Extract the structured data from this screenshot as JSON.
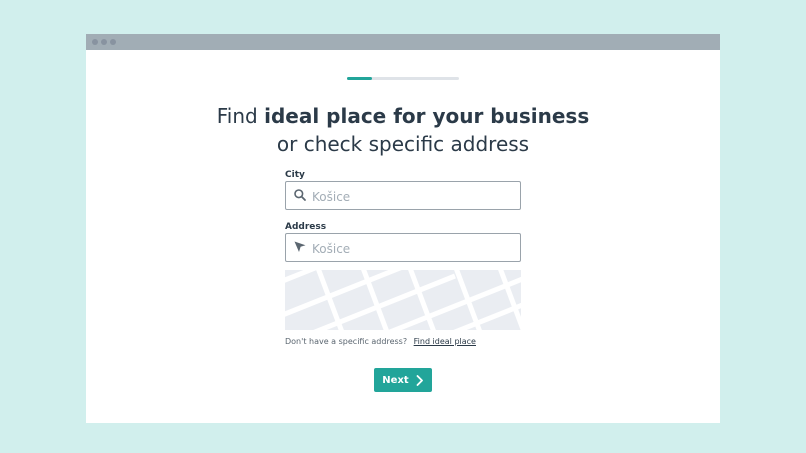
{
  "progress": {
    "value": 0.22
  },
  "heading": {
    "lead": "Find",
    "bold": "ideal place for your business",
    "sub": "or check specific address"
  },
  "city": {
    "label": "City",
    "placeholder": "Košice",
    "icon": "search-icon"
  },
  "address": {
    "label": "Address",
    "placeholder": "Košice",
    "icon": "location-arrow-icon"
  },
  "hint": {
    "text": "Don't have a specific address?",
    "link": "Find ideal place"
  },
  "next_button": {
    "label": "Next",
    "icon": "chevron-right-icon"
  },
  "colors": {
    "background": "#d1efed",
    "accent": "#22a59a",
    "titlebar": "#a1adb5",
    "text": "#2b3a48"
  }
}
